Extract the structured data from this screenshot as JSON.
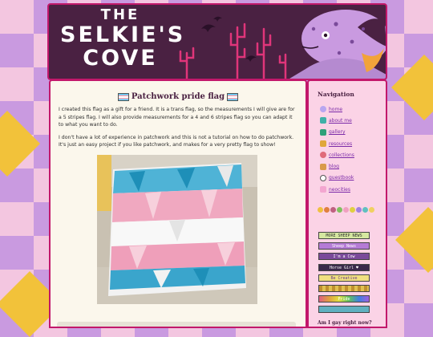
{
  "header": {
    "title_line1": "THE",
    "title_line2": "SELKIE'S",
    "title_line3": "COVE"
  },
  "post": {
    "title": "Patchwork pride flag",
    "paragraph1": "I created this flag as a gift for a friend. It is a trans flag, so the measurements I will give are for a 5 stripes flag. I will also provide measurements for a 4 and 6 stripes flag so you can adapt it to what you want to do.",
    "paragraph2": "I don't have a lot of experience in patchwork and this is not a tutorial on how to do patchwork. It's just an easy project if you like patchwork, and makes for a very pretty flag to show!",
    "photo_icon": "patchwork-flag-photo"
  },
  "sidebar": {
    "heading": "Navigation",
    "items": [
      {
        "label": "home",
        "icon": "heart-icon",
        "color": "#b8a6f0"
      },
      {
        "label": "about me",
        "icon": "note-icon",
        "color": "#3fb0a8"
      },
      {
        "label": "gallery",
        "icon": "pencil-icon",
        "color": "#2fa07a"
      },
      {
        "label": "resources",
        "icon": "pencil-pen-icon",
        "color": "#e0a73a"
      },
      {
        "label": "collections",
        "icon": "gem-icon",
        "color": "#e06a7a"
      },
      {
        "label": "blog",
        "icon": "bread-icon",
        "color": "#d99a4a"
      },
      {
        "label": "guestbook",
        "icon": "skull-icon",
        "color": "#ffffff"
      },
      {
        "label": "neocities",
        "icon": "cat-icon",
        "color": "#f3a6d0"
      }
    ],
    "badges": [
      {
        "label": "MORE SHEEP NEWS",
        "bg": "#d6e8a0",
        "fg": "#333333"
      },
      {
        "label": "Sheep News",
        "bg": "#b57bd6",
        "fg": "#ffffff"
      },
      {
        "label": "I'm a Cow",
        "bg": "#7a4a9a",
        "fg": "#ffffff"
      },
      {
        "label": "Horse Girl ♥",
        "bg": "#3a2a4a",
        "fg": "#ffffff"
      },
      {
        "label": "Be Creative",
        "bg": "#f0e080",
        "fg": "#6a3a8a"
      },
      {
        "label": "",
        "bg": "#c09030",
        "fg": "#ffffff"
      },
      {
        "label": "Pride",
        "bg": "#e0a0e0",
        "fg": "#ffffff"
      },
      {
        "label": "",
        "bg": "#60b0c0",
        "fg": "#ffffff"
      }
    ],
    "footer_text": "Am I gay right now?"
  },
  "colors": {
    "banner_bg": "#4a2142",
    "accent": "#c2186b",
    "panel_bg": "#fbf7ec",
    "sidebar_bg": "#fbd3e6",
    "link": "#7b2aa8"
  }
}
